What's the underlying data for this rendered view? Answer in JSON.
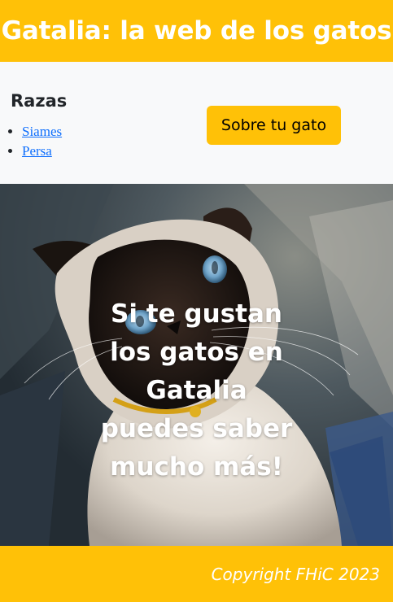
{
  "header": {
    "title": "Gatalia: la web de los gatos"
  },
  "nav": {
    "section_title": "Razas",
    "breeds": [
      "Siames",
      "Persa"
    ],
    "button_label": "Sobre tu gato"
  },
  "hero": {
    "image_subject": "siamese-cat-photo",
    "tagline": "Si te gustan los gatos en Gatalia puedes saber mucho más!"
  },
  "footer": {
    "copyright": "Copyright FHiC 2023"
  },
  "colors": {
    "accent": "#ffc107",
    "nav_background": "#f8f9fa",
    "link": "#0d6efd"
  }
}
